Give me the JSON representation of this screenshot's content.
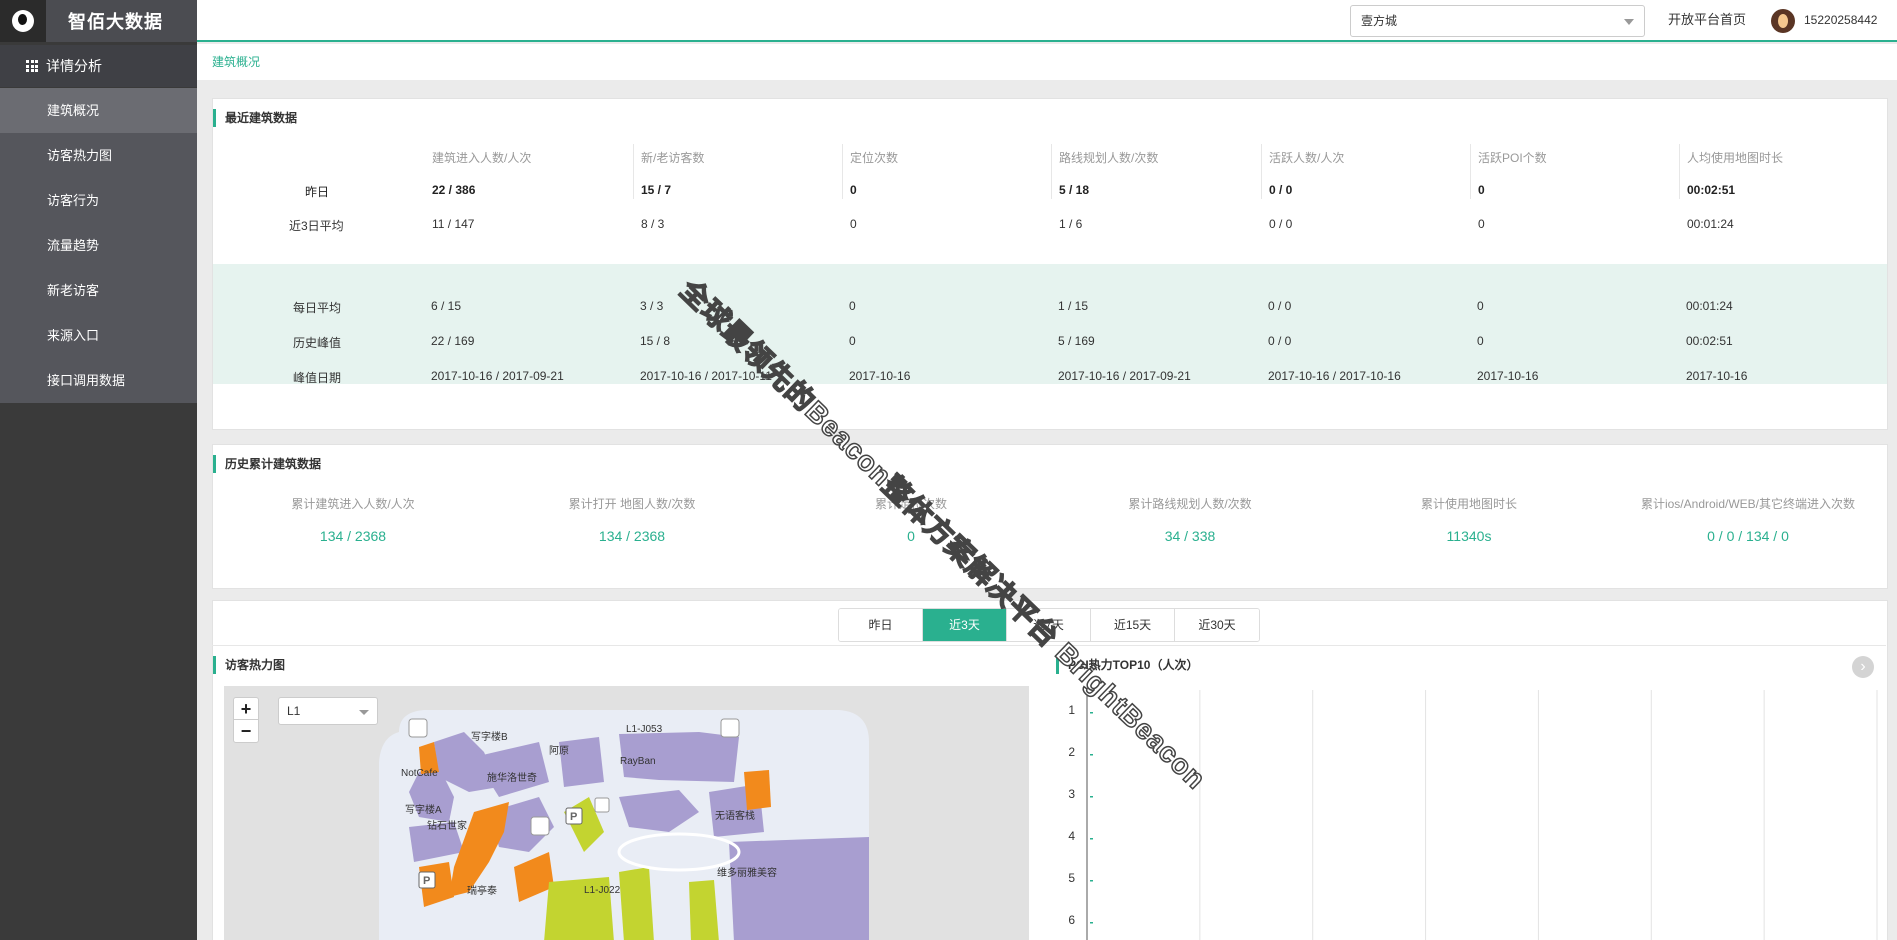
{
  "app": {
    "title": "智佰大数据"
  },
  "sidebar": {
    "section": "详情分析",
    "items": [
      {
        "label": "建筑概况"
      },
      {
        "label": "访客热力图"
      },
      {
        "label": "访客行为"
      },
      {
        "label": "流量趋势"
      },
      {
        "label": "新老访客"
      },
      {
        "label": "来源入口"
      },
      {
        "label": "接口调用数据"
      }
    ]
  },
  "topbar": {
    "building_select": "壹方城",
    "open_platform_link": "开放平台首页",
    "user_phone": "15220258442"
  },
  "breadcrumb": "建筑概况",
  "recent": {
    "title": "最近建筑数据",
    "headers": [
      "建筑进入人数/人次",
      "新/老访客数",
      "定位次数",
      "路线规划人数/次数",
      "活跃人数/人次",
      "活跃POI个数",
      "人均使用地图时长"
    ],
    "rows": [
      {
        "label": "昨日",
        "values": [
          "22 / 386",
          "15 / 7",
          "0",
          "5 / 18",
          "0 / 0",
          "0",
          "00:02:51"
        ]
      },
      {
        "label": "近3日平均",
        "values": [
          "11 / 147",
          "8 / 3",
          "0",
          "1 / 6",
          "0 / 0",
          "0",
          "00:01:24"
        ]
      },
      {
        "label": "每日平均",
        "values": [
          "6 / 15",
          "3 / 3",
          "0",
          "1 / 15",
          "0 / 0",
          "0",
          "00:01:24"
        ]
      },
      {
        "label": "历史峰值",
        "values": [
          "22 / 169",
          "15 / 8",
          "0",
          "5 / 169",
          "0 / 0",
          "0",
          "00:02:51"
        ]
      },
      {
        "label": "峰值日期",
        "values": [
          "2017-10-16 / 2017-09-21",
          "2017-10-16 / 2017-10-11",
          "2017-10-16",
          "2017-10-16 / 2017-09-21",
          "2017-10-16 / 2017-10-16",
          "2017-10-16",
          "2017-10-16"
        ]
      }
    ]
  },
  "history": {
    "title": "历史累计建筑数据",
    "items": [
      {
        "label": "累计建筑进入人数/人次",
        "value": "134 / 2368"
      },
      {
        "label": "累计打开 地图人数/次数",
        "value": "134 / 2368"
      },
      {
        "label": "累计定位次数",
        "value": "0"
      },
      {
        "label": "累计路线规划人数/次数",
        "value": "34 / 338"
      },
      {
        "label": "累计使用地图时长",
        "value": "11340s"
      },
      {
        "label": "累计ios/Android/WEB/其它终端进入次数",
        "value": "0 / 0 / 134 / 0"
      }
    ]
  },
  "range_tabs": {
    "options": [
      "昨日",
      "近3天",
      "近7天",
      "近15天",
      "近30天"
    ],
    "selected": "近3天"
  },
  "heatmap": {
    "title": "访客热力图",
    "floor": "L1",
    "zoom_in": "+",
    "zoom_out": "−",
    "map_labels": [
      "写字楼B",
      "L1-J053",
      "阿原",
      "NotCafe",
      "施华洛世奇",
      "RayBan",
      "写字楼A",
      "钻石世家",
      "无语客栈",
      "维多丽雅美容",
      "L1-J022",
      "瑞亭泰"
    ]
  },
  "poi": {
    "title": "POI热力TOP10（人次）",
    "next": "›"
  },
  "chart_data": {
    "type": "bar",
    "title": "POI热力TOP10（人次）",
    "categories": [
      "1",
      "2",
      "3",
      "4",
      "5",
      "6"
    ],
    "values": [
      0,
      0,
      0,
      0,
      0,
      0
    ],
    "xlabel": "",
    "ylabel": "",
    "grid": true
  },
  "watermark": "全球最领先的Beacon整体方案解决平台 BrightBeacon",
  "colors": {
    "accent": "#2ab08f",
    "sidebar": "#3a3a3a",
    "submenu": "#55565c"
  }
}
